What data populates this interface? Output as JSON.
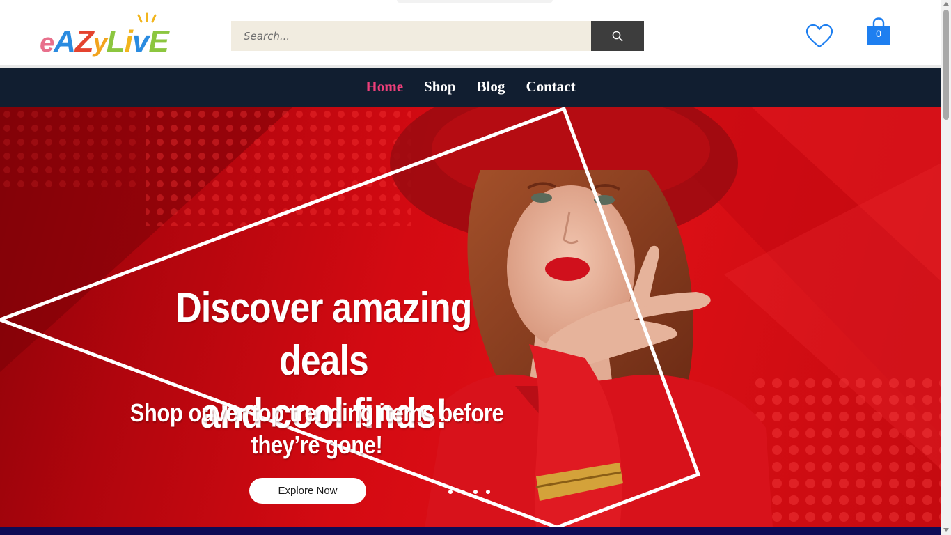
{
  "header": {
    "logo_text": "eAZyLivE",
    "search": {
      "placeholder": "Search..."
    },
    "icons": {
      "search": "search-icon",
      "wishlist": "heart-icon",
      "cart": "shopping-bag-icon"
    },
    "cart_count": "0"
  },
  "nav": {
    "items": [
      {
        "label": "Home",
        "active": true
      },
      {
        "label": "Shop",
        "active": false
      },
      {
        "label": "Blog",
        "active": false
      },
      {
        "label": "Contact",
        "active": false
      }
    ]
  },
  "hero": {
    "headline_1": "Discover amazing deals",
    "headline_2": "and cool finds!",
    "subline_1": "Shop ouver top trending items before",
    "subline_2": "they’re gone!",
    "cta_label": "Explore Now",
    "slide_count": 4,
    "active_slide": 1
  },
  "colors": {
    "nav_bg": "#111e30",
    "nav_active": "#ee3f7a",
    "hero_red": "#d40a12",
    "cart_blue": "#1e7ff0",
    "search_bg": "#f1ece0",
    "search_button": "#3d3d3d"
  }
}
